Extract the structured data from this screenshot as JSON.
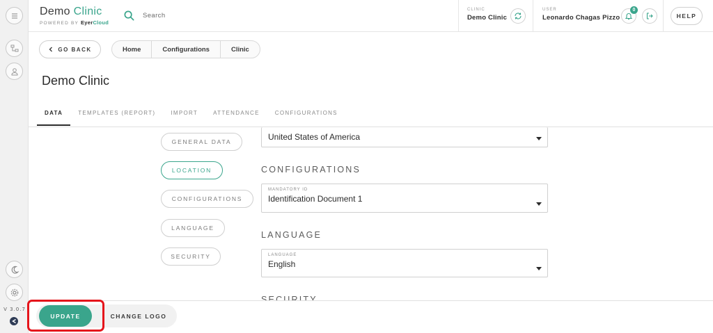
{
  "brand": {
    "title_main": "Demo",
    "title_accent": "Clinic",
    "powered_by": "POWERED BY",
    "vendor_a": "Eyer",
    "vendor_b": "Cloud"
  },
  "search": {
    "placeholder": "Search"
  },
  "clinic": {
    "label": "CLINIC",
    "value": "Demo Clinic"
  },
  "user": {
    "label": "USER",
    "value": "Leonardo Chagas Pizzo",
    "notifications": "0"
  },
  "help_label": "HELP",
  "back_label": "GO BACK",
  "breadcrumb": [
    "Home",
    "Configurations",
    "Clinic"
  ],
  "page_title": "Demo Clinic",
  "tabs": [
    "DATA",
    "TEMPLATES (REPORT)",
    "IMPORT",
    "ATTENDANCE",
    "CONFIGURATIONS"
  ],
  "active_tab": "DATA",
  "sections": [
    "GENERAL DATA",
    "LOCATION",
    "CONFIGURATIONS",
    "LANGUAGE",
    "SECURITY"
  ],
  "active_section": "LOCATION",
  "form": {
    "country_value": "United States of America",
    "configurations_heading": "CONFIGURATIONS",
    "mandatory_id_label": "MANDATORY ID",
    "mandatory_id_value": "Identification Document 1",
    "language_heading": "LANGUAGE",
    "language_label": "LANGUAGE",
    "language_value": "English",
    "security_heading": "SECURITY"
  },
  "footer": {
    "update_label": "UPDATE",
    "change_logo_label": "CHANGE LOGO"
  },
  "version": "V 3.0.7",
  "colors": {
    "accent": "#3aa58c",
    "highlight": "#e5141b"
  }
}
